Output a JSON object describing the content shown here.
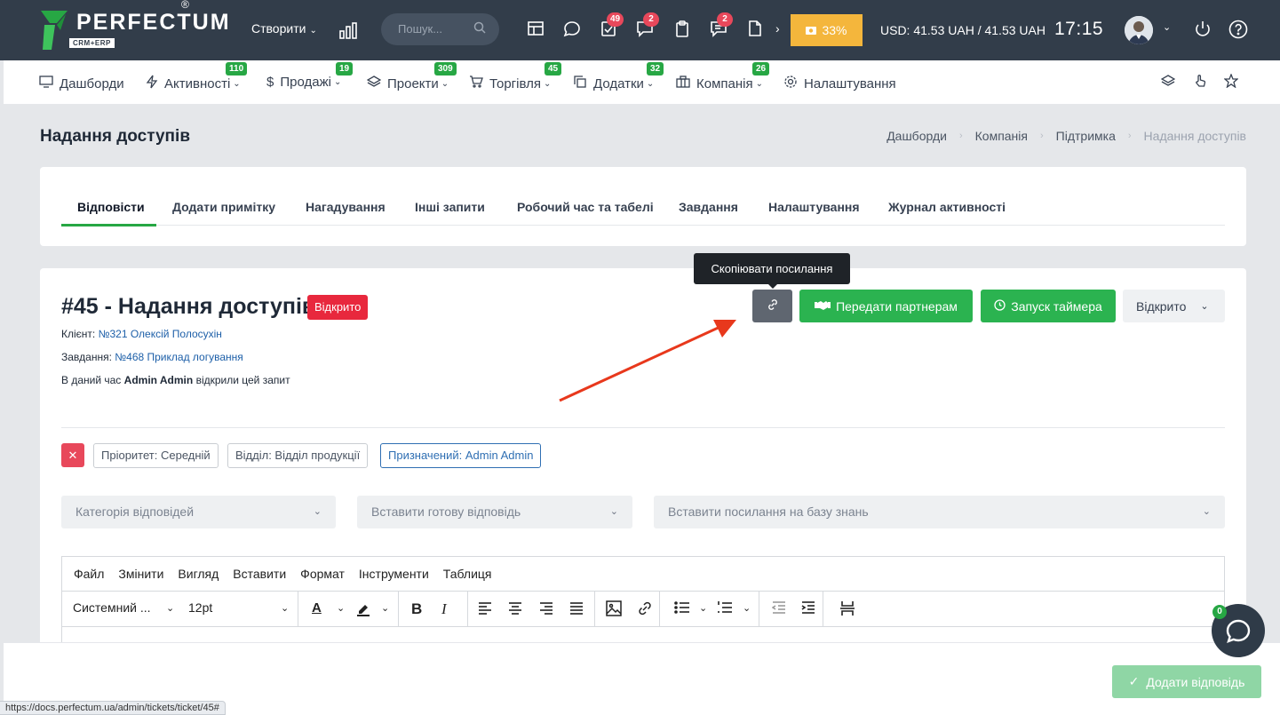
{
  "topbar": {
    "logo_text": "PERFECTUM",
    "logo_sub": "CRM+ERP",
    "logo_reg": "®",
    "create_label": "Створити",
    "search_placeholder": "Пошук...",
    "badges": {
      "tasks": "49",
      "replies": "2",
      "messages": "2"
    },
    "progress_label": "33%",
    "currency": "USD: 41.53 UAH / 41.53 UAH",
    "time": "17:15",
    "colors": {
      "bar": "#323d4a",
      "progress": "#f4b63c"
    }
  },
  "nav": {
    "items": [
      {
        "label": "Дашборди",
        "badge": ""
      },
      {
        "label": "Активності",
        "badge": "110"
      },
      {
        "label": "Продажі",
        "badge": "19"
      },
      {
        "label": "Проекти",
        "badge": "309"
      },
      {
        "label": "Торгівля",
        "badge": "45"
      },
      {
        "label": "Додатки",
        "badge": "32"
      },
      {
        "label": "Компанія",
        "badge": "26"
      },
      {
        "label": "Налаштування",
        "badge": ""
      }
    ]
  },
  "page": {
    "title": "Надання доступів",
    "breadcrumb": [
      "Дашборди",
      "Компанія",
      "Підтримка",
      "Надання доступів"
    ]
  },
  "tabs": [
    "Відповісти",
    "Додати примітку",
    "Нагадування",
    "Інші запити",
    "Робочий час та табелі",
    "Завдання",
    "Налаштування",
    "Журнал активності"
  ],
  "ticket": {
    "title": "#45 - Надання доступів",
    "status": "Відкрито",
    "client_label": "Клієнт:",
    "client_value": "№321 Олексій Полосухін",
    "task_label": "Завдання:",
    "task_value": "№468 Приклад логування",
    "viewing_prefix": "В даний час",
    "viewing_user": "Admin Admin",
    "viewing_suffix": "відкрили цей запит",
    "tooltip": "Скопіювати посилання",
    "share_label": "Передати партнерам",
    "timer_label": "Запуск таймера",
    "status_select": "Відкрито",
    "tags": {
      "priority": "Пріоритет: Середній",
      "department": "Відділ: Відділ продукції",
      "assigned": "Призначений: Admin Admin"
    },
    "selects": {
      "category": "Категорія відповідей",
      "predefined": "Вставити готову відповідь",
      "kb": "Вставити посилання на базу знань"
    }
  },
  "editor": {
    "menu": [
      "Файл",
      "Змінити",
      "Вигляд",
      "Вставити",
      "Формат",
      "Інструменти",
      "Таблиця"
    ],
    "font": "Системний ...",
    "size": "12pt"
  },
  "footer": {
    "add_reply": "Додати відповідь",
    "chat_badge": "0",
    "status_url": "https://docs.perfectum.ua/admin/tickets/ticket/45#"
  }
}
